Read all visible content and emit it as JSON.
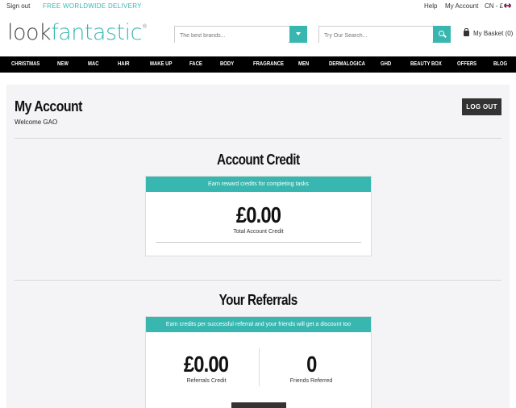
{
  "topbar": {
    "sign_out": "Sign out",
    "free_delivery": "FREE WORLDWIDE DELIVERY",
    "help": "Help",
    "my_account": "My Account",
    "locale": "CN - £"
  },
  "header": {
    "logo_part1": "look",
    "logo_part2": "fantastic",
    "logo_mark": "®",
    "brand_placeholder": "The best brands...",
    "search_placeholder": "Try Our Search...",
    "basket": "My Basket (0)"
  },
  "nav": [
    "CHRISTMAS",
    "NEW",
    "MAC",
    "HAIR",
    "MAKE UP",
    "FACE",
    "BODY",
    "FRAGRANCE",
    "MEN",
    "DERMALOGICA",
    "GHD",
    "BEAUTY BOX",
    "OFFERS",
    "BLOG"
  ],
  "account": {
    "title": "My Account",
    "welcome": "Welcome GAO",
    "logout": "LOG OUT"
  },
  "credit": {
    "heading": "Account Credit",
    "banner": "Earn reward credits for completing tasks",
    "amount": "£0.00",
    "label": "Total Account Credit"
  },
  "referrals": {
    "heading": "Your Referrals",
    "banner": "Earn credits per successful referral and your friends will get a discount too",
    "credit_amount": "£0.00",
    "credit_label": "Referrals Credit",
    "friends_count": "0",
    "friends_label": "Friends Referred"
  },
  "colors": {
    "accent": "#37b7b0",
    "nav_bg": "#000000",
    "button_dark": "#333333",
    "page_bg": "#f4f3f5"
  }
}
